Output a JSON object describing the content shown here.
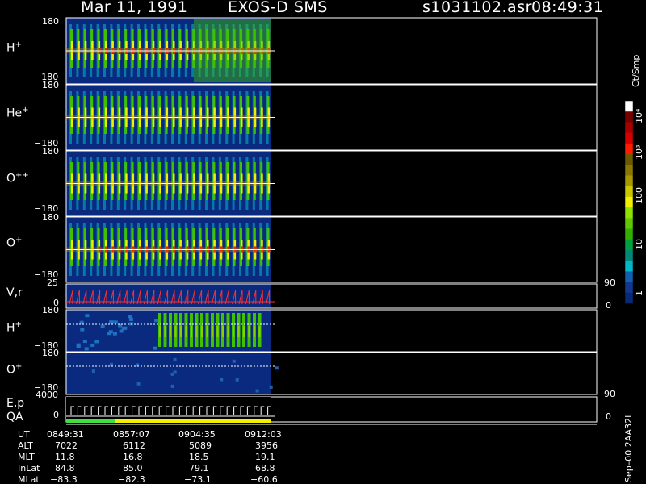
{
  "header": {
    "date": "Mar 11, 1991",
    "instrument": "EXOS-D SMS",
    "file": "s1031102.asr",
    "time": "08:49:31"
  },
  "panels": [
    {
      "label": "H",
      "sup": "+",
      "top_tick": "180",
      "bottom_tick": "−180"
    },
    {
      "label": "He",
      "sup": "+",
      "top_tick": "180",
      "bottom_tick": "−180"
    },
    {
      "label": "O",
      "sup": "++",
      "top_tick": "180",
      "bottom_tick": "−180"
    },
    {
      "label": "O",
      "sup": "+",
      "top_tick": "180",
      "bottom_tick": "−180"
    },
    {
      "label": "V,r",
      "sup": "",
      "top_tick": "25",
      "bottom_tick": "0",
      "right_top": "90",
      "right_bottom": "0"
    },
    {
      "label": "H",
      "sup": "+",
      "top_tick": "180",
      "bottom_tick": "−180"
    },
    {
      "label": "O",
      "sup": "+",
      "top_tick": "180",
      "bottom_tick": "−180"
    },
    {
      "label": "E,p",
      "sup": "",
      "top_tick": "4000",
      "bottom_tick": "0",
      "right_top": "90",
      "right_bottom": "0"
    }
  ],
  "qa_label": "QA",
  "colorbar": {
    "unit": "Ct/Smp",
    "ticks": [
      "10⁴",
      "10³",
      "100",
      "10",
      "1"
    ],
    "colors": [
      "#ffffff",
      "#7a0000",
      "#a80000",
      "#d40000",
      "#ff1a00",
      "#6b5a00",
      "#8a7800",
      "#a89800",
      "#c8c800",
      "#f0f000",
      "#90e000",
      "#60c800",
      "#30b000",
      "#00a040",
      "#008878",
      "#00b8c8",
      "#1060b0",
      "#103890",
      "#082878"
    ]
  },
  "footer": {
    "rows": [
      {
        "label": "UT",
        "values": [
          "0849:31",
          "0857:07",
          "0904:35",
          "0912:03"
        ]
      },
      {
        "label": "ALT",
        "values": [
          "7022",
          "6112",
          "5089",
          "3956"
        ]
      },
      {
        "label": "MLT",
        "values": [
          "11.8",
          "16.8",
          "18.5",
          "19.1"
        ]
      },
      {
        "label": "InLat",
        "values": [
          "84.8",
          "85.0",
          "79.1",
          "68.8"
        ]
      },
      {
        "label": "MLat",
        "values": [
          "−83.3",
          "−82.3",
          "−73.1",
          "−60.6"
        ]
      }
    ],
    "side_note": "Sep–00  2AA32L"
  },
  "chart_data": {
    "type": "heatmap",
    "x": {
      "label": "UT",
      "ticks": [
        "0849:31",
        "0857:07",
        "0904:35",
        "0912:03"
      ]
    },
    "panels": [
      {
        "name": "H+",
        "ylim": [
          -180,
          180
        ],
        "data_extent": "0849:31 to ~0912:30"
      },
      {
        "name": "He+",
        "ylim": [
          -180,
          180
        ]
      },
      {
        "name": "O++",
        "ylim": [
          -180,
          180
        ]
      },
      {
        "name": "O+",
        "ylim": [
          -180,
          180
        ]
      },
      {
        "name": "V,r",
        "ylim": [
          0,
          25
        ],
        "right_axis": [
          0,
          90
        ]
      },
      {
        "name": "H+",
        "ylim": [
          -180,
          180
        ]
      },
      {
        "name": "O+",
        "ylim": [
          -180,
          180
        ]
      },
      {
        "name": "E,p",
        "ylim": [
          0,
          4000
        ],
        "right_axis": [
          0,
          90
        ]
      }
    ],
    "colorbar": {
      "scale": "log",
      "range": [
        1,
        10000
      ],
      "unit": "Ct/Smp"
    }
  }
}
